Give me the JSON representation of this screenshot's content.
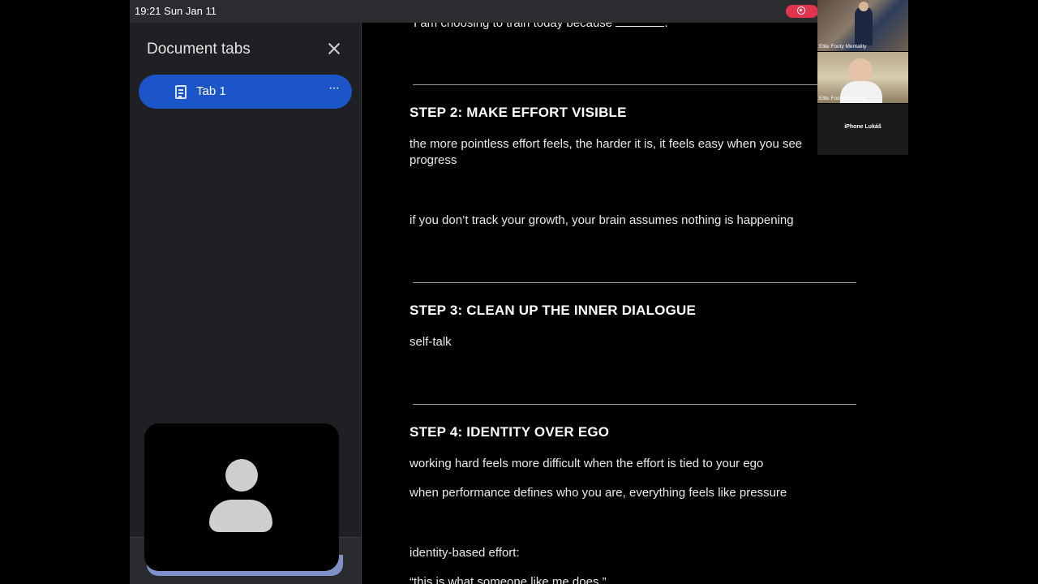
{
  "status_bar": {
    "time_date": "19:21   Sun Jan 11"
  },
  "tabs_panel": {
    "title": "Document tabs",
    "tab": {
      "label": "Tab 1",
      "more": "···"
    }
  },
  "document": {
    "lines": [
      {
        "id": "l0",
        "text": "“I am choosing to train today because ",
        "suffix": "."
      },
      {
        "id": "h2",
        "text": "STEP 2: MAKE EFFORT VISIBLE"
      },
      {
        "id": "p2a",
        "text": "the more pointless effort feels, the harder it is, it feels easy when you see progress"
      },
      {
        "id": "p2b",
        "text": "if you don’t track your growth, your brain assumes nothing is happening"
      },
      {
        "id": "h3",
        "text": "STEP 3: CLEAN UP THE INNER DIALOGUE"
      },
      {
        "id": "p3a",
        "text": "self-talk"
      },
      {
        "id": "h4",
        "text": "STEP 4: IDENTITY OVER EGO"
      },
      {
        "id": "p4a",
        "text": "working hard feels more difficult when the effort is tied to your ego"
      },
      {
        "id": "p4b",
        "text": "when performance defines who you are, everything feels like pressure"
      },
      {
        "id": "p4c",
        "text": "identity-based effort:"
      },
      {
        "id": "p4d",
        "text": "“this is what someone like me does.”"
      }
    ]
  },
  "participants": [
    {
      "caption": "Elite Footy Mentality"
    },
    {
      "caption": "Elite Footy Mentality"
    },
    {
      "name": "iPhone Lukáš"
    }
  ],
  "colors": {
    "accent_tab": "#1b55c7",
    "record": "#e0344f",
    "panel_bg": "#1f2023"
  },
  "icons": [
    "document-icon",
    "close-icon",
    "more-icon",
    "record-icon",
    "person-icon"
  ]
}
